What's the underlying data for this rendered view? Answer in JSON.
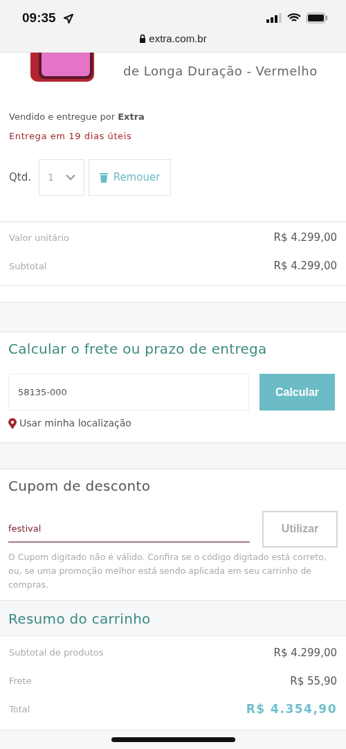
{
  "status_bar": {
    "time": "09:35",
    "url": "extra.com.br"
  },
  "product": {
    "title_lines": [
      "de Longa Duração - Vermelho"
    ],
    "seller_prefix": "Vendido e entregue por ",
    "seller": "Extra",
    "delivery": "Entrega em 19 dias úteis",
    "qty_label": "Qtd.",
    "qty_value": "1",
    "remove_label": "Remouer"
  },
  "price_rows": [
    {
      "label": "Valor unitário",
      "value": "R$ 4.299,00"
    },
    {
      "label": "Subtotal",
      "value": "R$ 4.299,00"
    }
  ],
  "shipping": {
    "title": "Calcular o frete ou prazo de entrega",
    "zip_value": "58135-000",
    "button": "Calcular",
    "location_link": "Usar minha localização"
  },
  "coupon": {
    "title": "Cupom de desconto",
    "code_value": "festival",
    "invalid": true,
    "button": "Utilizar",
    "error": "O Cupom digitado não é válido. Confira se o código digitado está correto, ou, se uma promoção melhor está sendo aplicada em seu carrinho de compras."
  },
  "summary": {
    "title": "Resumo do carrinho",
    "rows": [
      {
        "kind": "normal",
        "label": "Subtotal de produtos",
        "value": "R$ 4.299,00"
      },
      {
        "kind": "normal",
        "label": "Frete",
        "value": "R$ 55,90"
      },
      {
        "kind": "total",
        "label": "Total",
        "value": "R$ 4.354,90"
      }
    ]
  }
}
